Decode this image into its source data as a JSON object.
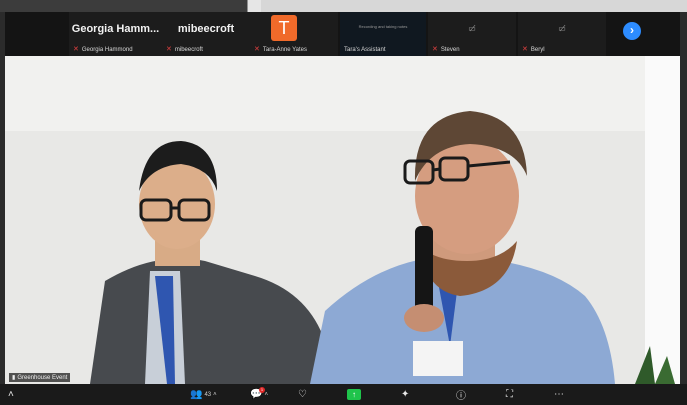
{
  "participants": [
    {
      "display": "Georgia  Hamm...",
      "label": "Georgia Hammond",
      "type": "name-tile"
    },
    {
      "display": "mibeecroft",
      "label": "mibeecroft",
      "type": "name-tile"
    },
    {
      "display": "T",
      "label": "Tara-Anne Yates",
      "type": "avatar"
    },
    {
      "display": "Recording and taking notes",
      "label": "Tara's Assistant",
      "type": "text-tile"
    },
    {
      "display": "",
      "label": "Steven",
      "type": "camera-off"
    },
    {
      "display": "",
      "label": "Beryl",
      "type": "camera-off"
    }
  ],
  "main_video": {
    "speaker_label": "Greenhouse Event"
  },
  "toolbar": {
    "participants_count": "43",
    "chat_badge": "1"
  },
  "colors": {
    "accent_blue": "#2d8cff",
    "share_green": "#1fc44b",
    "avatar_orange": "#f06a2a",
    "mute_red": "#e04040"
  }
}
